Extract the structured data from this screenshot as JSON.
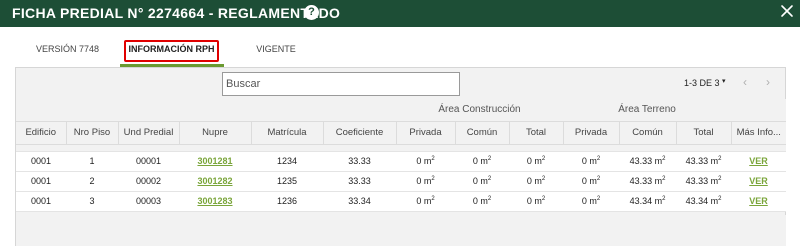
{
  "window": {
    "title": "FICHA PREDIAL N° 2274664 - REGLAMENTADO",
    "help_icon": "question-circle-icon",
    "help_glyph": "?",
    "close_icon": "close-icon"
  },
  "tabs": [
    {
      "label": "VERSIÓN 7748",
      "active": false
    },
    {
      "label": "INFORMACIÓN RPH",
      "active": true
    },
    {
      "label": "VIGENTE",
      "active": false
    }
  ],
  "colors": {
    "titlebar": "#1d4e36",
    "accent": "#6b9a31",
    "link": "#7aa53a",
    "highlight": "#e00000"
  },
  "search": {
    "placeholder": "Buscar",
    "value": ""
  },
  "pager": {
    "range_text": "1-3 DE 3",
    "caret": "▾",
    "prev_icon": "chevron-left-icon",
    "prev_glyph": "‹",
    "next_icon": "chevron-right-icon",
    "next_glyph": "›"
  },
  "table": {
    "group_headers": {
      "construccion": "Área Construcción",
      "terreno": "Área Terreno"
    },
    "columns": [
      "Edificio",
      "Nro Piso",
      "Und Predial",
      "Nupre",
      "Matrícula",
      "Coeficiente",
      "Privada",
      "Común",
      "Total",
      "Privada",
      "Común",
      "Total",
      "Más Info..."
    ],
    "rows": [
      {
        "edificio": "0001",
        "piso": "1",
        "und": "00001",
        "nupre": "3001281",
        "matricula": "1234",
        "coeficiente": "33.33",
        "c_privada": "0 m",
        "c_comun": "0 m",
        "c_total": "0 m",
        "t_privada": "0 m",
        "t_comun": "43.33 m",
        "t_total": "43.33 m",
        "mas": "VER"
      },
      {
        "edificio": "0001",
        "piso": "2",
        "und": "00002",
        "nupre": "3001282",
        "matricula": "1235",
        "coeficiente": "33.33",
        "c_privada": "0 m",
        "c_comun": "0 m",
        "c_total": "0 m",
        "t_privada": "0 m",
        "t_comun": "43.33 m",
        "t_total": "43.33 m",
        "mas": "VER"
      },
      {
        "edificio": "0001",
        "piso": "3",
        "und": "00003",
        "nupre": "3001283",
        "matricula": "1236",
        "coeficiente": "33.34",
        "c_privada": "0 m",
        "c_comun": "0 m",
        "c_total": "0 m",
        "t_privada": "0 m",
        "t_comun": "43.34 m",
        "t_total": "43.34 m",
        "mas": "VER"
      }
    ],
    "unit_sup": "2"
  }
}
